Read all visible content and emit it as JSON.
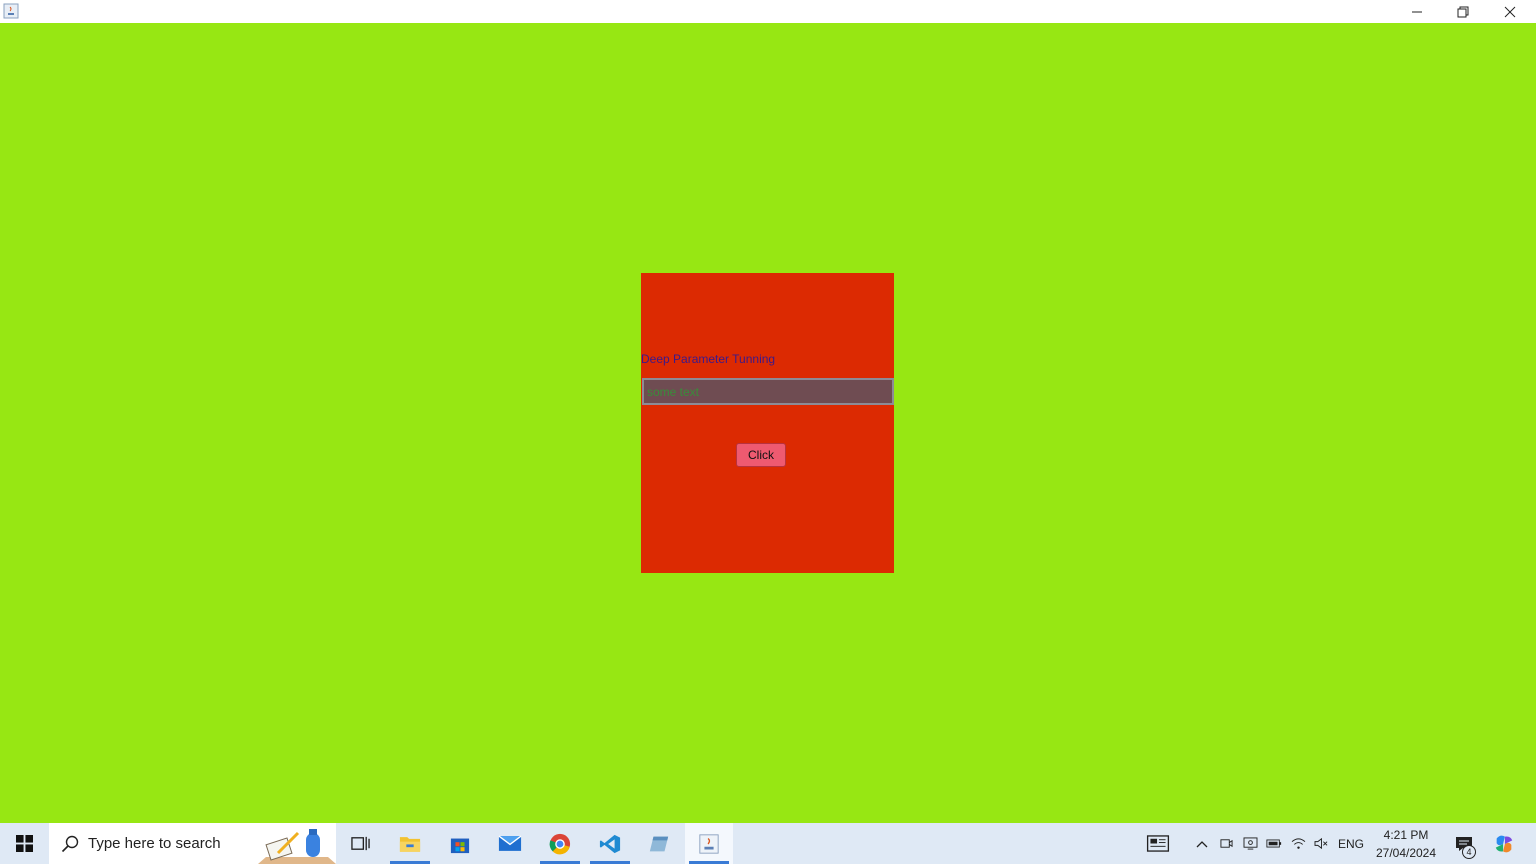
{
  "window": {
    "title": "",
    "controls": {
      "minimize": "minimize-icon",
      "restore": "restore-icon",
      "close": "close-icon"
    }
  },
  "panel": {
    "label": "Deep Parameter Tunning",
    "field_placeholder": "some text",
    "button_label": "Click"
  },
  "taskbar": {
    "search_placeholder": "Type here to search",
    "apps": [
      "task-view",
      "file-explorer",
      "microsoft-store",
      "mail",
      "chrome",
      "vscode",
      "app",
      "java"
    ],
    "language": "ENG",
    "time": "4:21 PM",
    "date": "27/04/2024",
    "notification_count": "4"
  },
  "colors": {
    "background": "#97e713",
    "panel": "#dc2a02",
    "button": "#ee5a70",
    "field": "#6f4c52"
  }
}
